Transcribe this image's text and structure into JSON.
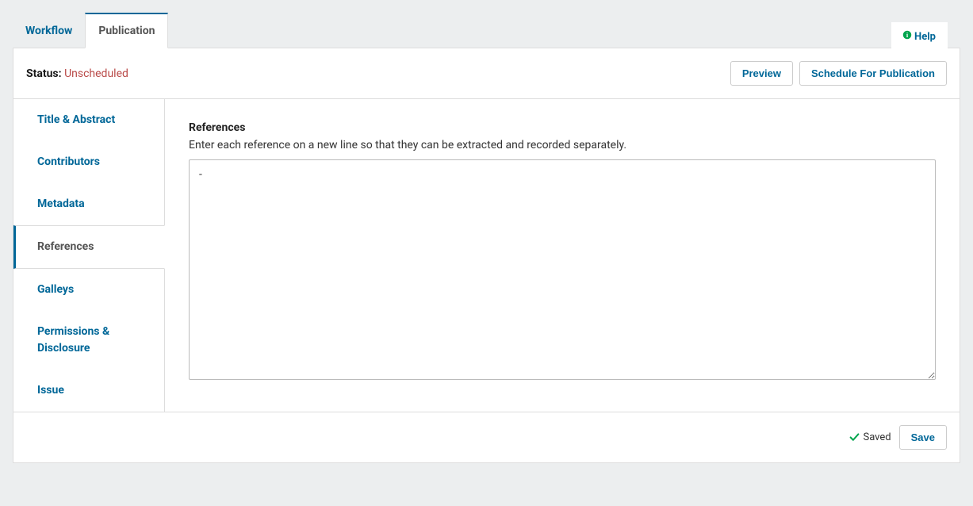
{
  "help_label": "Help",
  "tabs": {
    "workflow": "Workflow",
    "publication": "Publication"
  },
  "status": {
    "label": "Status:",
    "value": "Unscheduled"
  },
  "buttons": {
    "preview": "Preview",
    "schedule": "Schedule For Publication",
    "save": "Save"
  },
  "sidenav": {
    "title_abstract": "Title & Abstract",
    "contributors": "Contributors",
    "metadata": "Metadata",
    "references": "References",
    "galleys": "Galleys",
    "permissions": "Permissions & Disclosure",
    "issue": "Issue"
  },
  "references": {
    "heading": "References",
    "description": "Enter each reference on a new line so that they can be extracted and recorded separately.",
    "value": "-"
  },
  "saved_label": "Saved"
}
